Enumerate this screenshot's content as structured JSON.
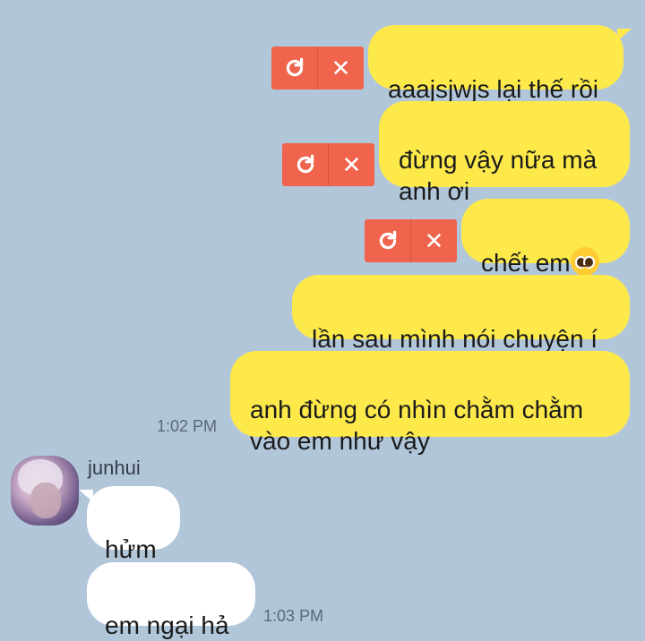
{
  "conversation": {
    "outgoing": [
      {
        "text": "aaajsjwjs lại thế rồi",
        "failed": true
      },
      {
        "text": "đừng vậy nữa mà\nanh ơi",
        "failed": true
      },
      {
        "text": "chết em",
        "failed": true,
        "emoji": "pleading-face-emoji"
      },
      {
        "text": "lần sau mình nói chuyện í",
        "failed": false
      },
      {
        "text": "anh đừng có nhìn chằm chằm\nvào em như vậy",
        "failed": false
      }
    ],
    "outgoing_time": "1:02 PM",
    "sender": {
      "name": "junhui",
      "avatar": "avatar-image"
    },
    "incoming": [
      {
        "text": "hửm"
      },
      {
        "text": "em ngại hả"
      }
    ],
    "incoming_time": "1:03 PM"
  },
  "icons": {
    "retry": "retry-icon",
    "delete": "close-icon"
  },
  "colors": {
    "background": "#b2c6da",
    "outgoing_bubble": "#fde94a",
    "incoming_bubble": "#ffffff",
    "failed_actions": "#f0634c"
  }
}
